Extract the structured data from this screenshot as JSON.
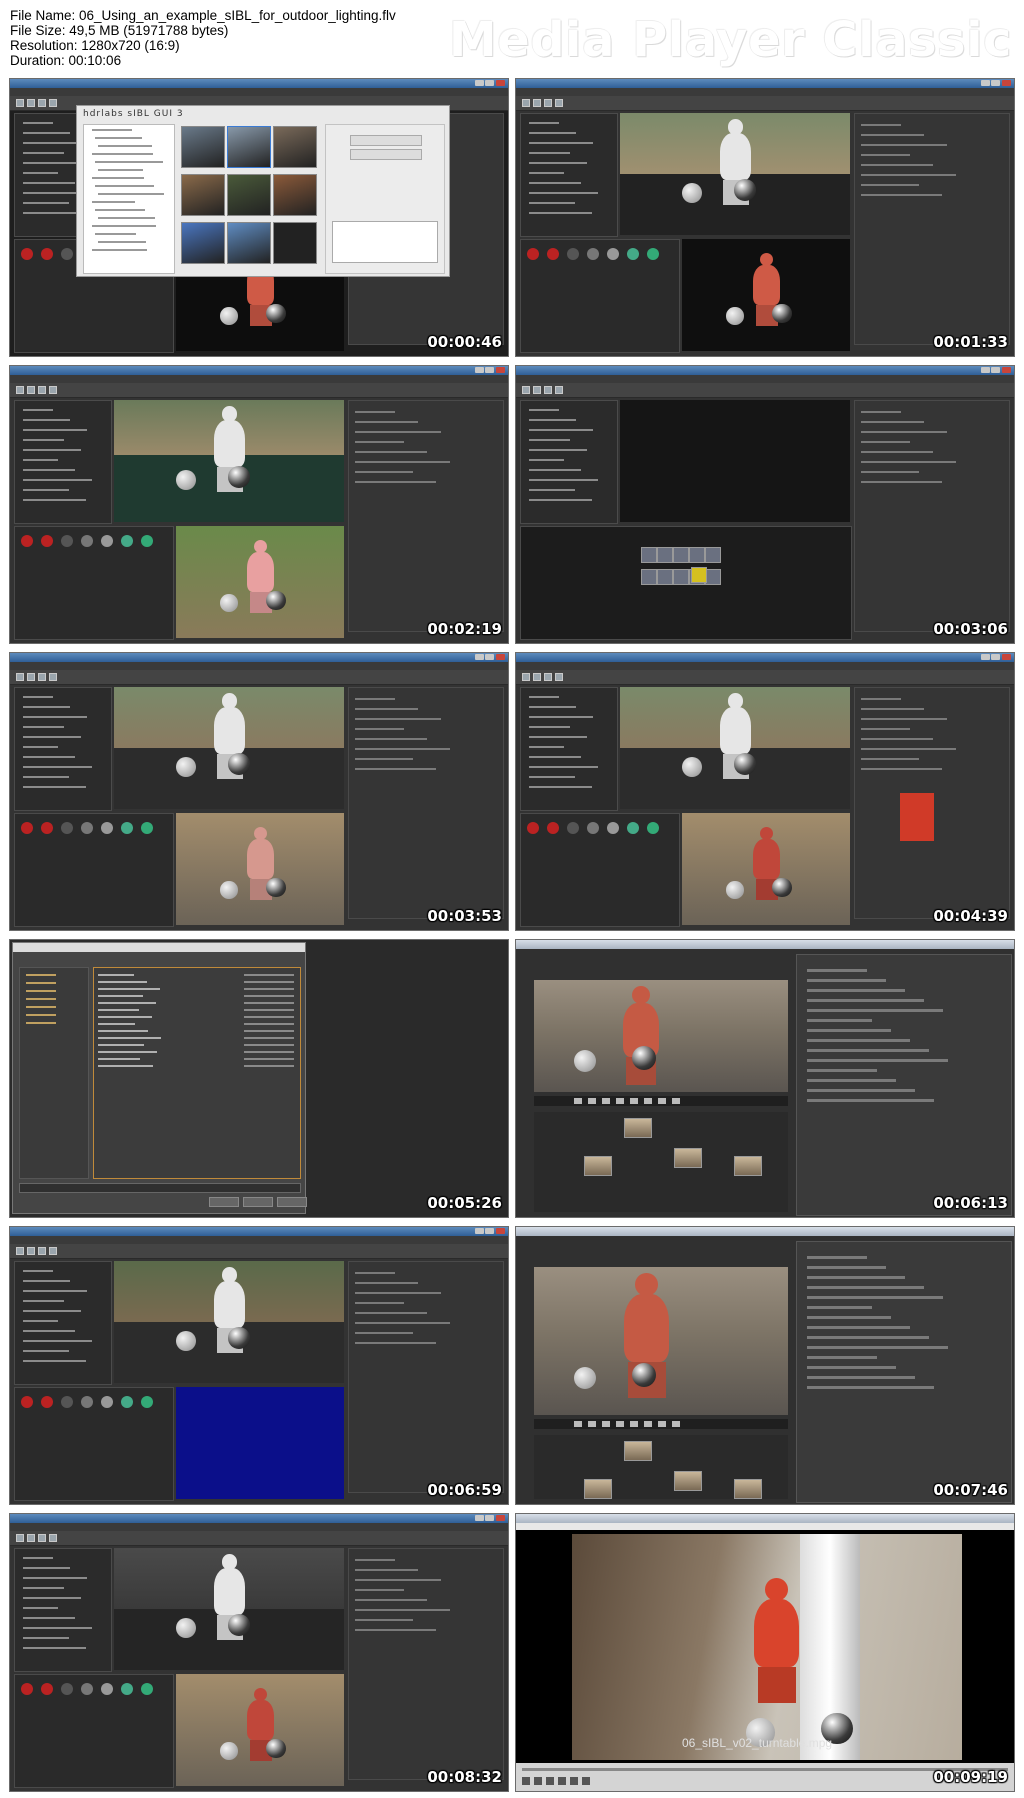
{
  "header": {
    "file_name": "File Name: 06_Using_an_example_sIBL_for_outdoor_lighting.flv",
    "file_size": "File Size: 49,5 MB (51971788 bytes)",
    "resolution": "Resolution: 1280x720 (16:9)",
    "duration": "Duration: 00:10:06",
    "brand": "Media Player Classic"
  },
  "thumbnails": [
    {
      "timestamp": "00:00:46",
      "scene": "sibl-gui",
      "title": "hdrlabs  sIBL GUI  3"
    },
    {
      "timestamp": "00:01:33",
      "scene": "maya-garden"
    },
    {
      "timestamp": "00:02:19",
      "scene": "maya-grid"
    },
    {
      "timestamp": "00:03:06",
      "scene": "maya-hypershade"
    },
    {
      "timestamp": "00:03:53",
      "scene": "maya-alley"
    },
    {
      "timestamp": "00:04:39",
      "scene": "maya-alley-red"
    },
    {
      "timestamp": "00:05:26",
      "scene": "read-file"
    },
    {
      "timestamp": "00:06:13",
      "scene": "nuke-1"
    },
    {
      "timestamp": "00:06:59",
      "scene": "maya-blue"
    },
    {
      "timestamp": "00:07:46",
      "scene": "nuke-2"
    },
    {
      "timestamp": "00:08:32",
      "scene": "maya-dark"
    },
    {
      "timestamp": "00:09:19",
      "scene": "mplayer",
      "caption": "06_sIBL_v02_turntable.mpg"
    }
  ],
  "colors": {
    "window_title": "#2f5f97",
    "ui_dark": "#2b2b2b",
    "statue_red": "#d0563f",
    "statue_white": "#e8e8e8"
  }
}
